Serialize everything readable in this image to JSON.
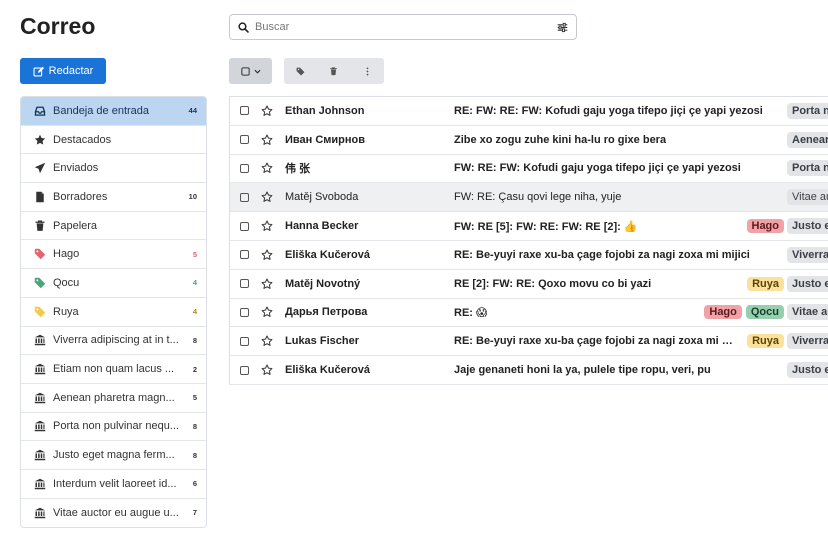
{
  "app": {
    "title": "Correo"
  },
  "compose": {
    "label": "Redactar",
    "icon": "pencil-square-icon"
  },
  "search": {
    "placeholder": "Buscar",
    "value": ""
  },
  "colors": {
    "accent": "#1a73d6",
    "active_bg": "#bcd6f1",
    "hago": "#f1a2a7",
    "qocu": "#96cfb0",
    "ruya": "#fbe19b"
  },
  "sidebar": {
    "items": [
      {
        "label": "Bandeja de entrada",
        "count": "44",
        "icon": "inbox-icon",
        "active": true
      },
      {
        "label": "Destacados",
        "count": "",
        "icon": "star-filled-icon"
      },
      {
        "label": "Enviados",
        "count": "",
        "icon": "send-icon"
      },
      {
        "label": "Borradores",
        "count": "10",
        "icon": "draft-icon"
      },
      {
        "label": "Papelera",
        "count": "",
        "icon": "trash-icon"
      },
      {
        "label": "Hago",
        "count": "5",
        "icon": "tag-icon",
        "color": "#e0656f"
      },
      {
        "label": "Qocu",
        "count": "4",
        "icon": "tag-icon",
        "color": "#4aa57a"
      },
      {
        "label": "Ruya",
        "count": "4",
        "icon": "tag-icon",
        "color": "#f2c94c"
      },
      {
        "label": "Viverra adipiscing at in t...",
        "count": "8",
        "icon": "bank-icon"
      },
      {
        "label": "Etiam non quam lacus ...",
        "count": "2",
        "icon": "bank-icon"
      },
      {
        "label": "Aenean pharetra magn...",
        "count": "5",
        "icon": "bank-icon"
      },
      {
        "label": "Porta non pulvinar nequ...",
        "count": "8",
        "icon": "bank-icon"
      },
      {
        "label": "Justo eget magna ferm...",
        "count": "8",
        "icon": "bank-icon"
      },
      {
        "label": "Interdum velit laoreet id...",
        "count": "6",
        "icon": "bank-icon"
      },
      {
        "label": "Vitae auctor eu augue u...",
        "count": "7",
        "icon": "bank-icon"
      }
    ]
  },
  "messages": [
    {
      "sender": "Ethan Johnson",
      "subject": "RE: FW: RE: FW: Kofudi gaju yoga tifepo jiçi çe yapi yezosi",
      "tags": [],
      "folder": "Porta n",
      "read": false
    },
    {
      "sender": "Иван Смирнов",
      "subject": "Zibe xo zogu zuhe kini ha-lu ro gixe bera",
      "tags": [],
      "folder": "Aenear",
      "read": false
    },
    {
      "sender": "伟 张",
      "subject": "FW: RE: FW: Kofudi gaju yoga tifepo jiçi çe yapi yezosi",
      "tags": [],
      "folder": "Porta n",
      "read": false
    },
    {
      "sender": "Matěj Svoboda",
      "subject": "FW: RE: Çasu qovi lege niha, yuje",
      "tags": [],
      "folder": "Vitae au",
      "read": true
    },
    {
      "sender": "Hanna Becker",
      "subject": "FW: RE [5]: FW: RE: FW: RE [2]: 👍",
      "tags": [
        "Hago"
      ],
      "folder": "Justo e",
      "read": false
    },
    {
      "sender": "Eliška Kučerová",
      "subject": "RE: Be-yuyi raxe xu-ba çage fojobi za nagi zoxa mi mijici",
      "tags": [],
      "folder": "Viverra",
      "read": false
    },
    {
      "sender": "Matěj Novotný",
      "subject": "RE [2]: FW: RE: Qoxo movu co bi yazi",
      "tags": [
        "Ruya"
      ],
      "folder": "Justo e",
      "read": false
    },
    {
      "sender": "Дарья Петрова",
      "subject": "RE: 😱",
      "tags": [
        "Hago",
        "Qocu"
      ],
      "folder": "Vitae au",
      "read": false
    },
    {
      "sender": "Lukas Fischer",
      "subject": "RE: Be-yuyi raxe xu-ba çage fojobi za nagi zoxa mi mijici",
      "tags": [
        "Ruya"
      ],
      "folder": "Viverra",
      "read": false
    },
    {
      "sender": "Eliška Kučerová",
      "subject": "Jaje genaneti honi la ya, pulele tipe ropu, veri, pu",
      "tags": [],
      "folder": "Justo e",
      "read": false
    }
  ]
}
